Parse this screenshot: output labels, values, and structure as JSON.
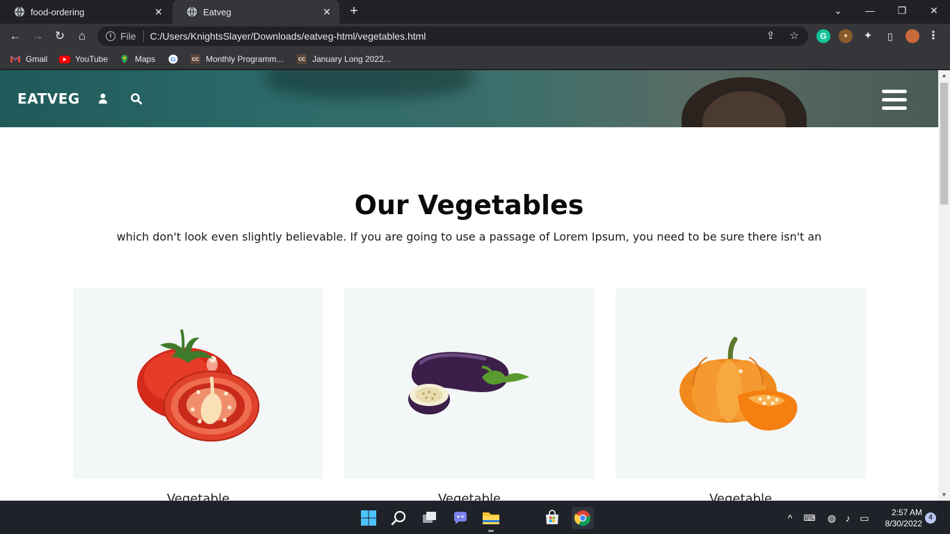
{
  "browser": {
    "tabs": [
      {
        "title": "food-ordering",
        "active": false
      },
      {
        "title": "Eatveg",
        "active": true
      }
    ],
    "address": {
      "scheme": "File",
      "url": "C:/Users/KnightsSlayer/Downloads/eatveg-html/vegetables.html"
    },
    "bookmarks": [
      {
        "label": "Gmail"
      },
      {
        "label": "YouTube"
      },
      {
        "label": "Maps"
      },
      {
        "label": ""
      },
      {
        "label": "Monthly Programm..."
      },
      {
        "label": "January Long 2022..."
      }
    ],
    "profile_initial": "G"
  },
  "page": {
    "brand": "EATVEG",
    "section_title": "Our Vegetables",
    "section_subtitle": "which don't look even slightly believable. If you are going to use a passage of Lorem Ipsum, you need to be sure there isn't an",
    "cards": [
      {
        "label": "Vegetable",
        "image": "tomato"
      },
      {
        "label": "Vegetable",
        "image": "eggplant"
      },
      {
        "label": "Vegetable",
        "image": "pumpkin"
      }
    ]
  },
  "taskbar": {
    "time": "2:57 AM",
    "date": "8/30/2022",
    "notifications": "4"
  }
}
